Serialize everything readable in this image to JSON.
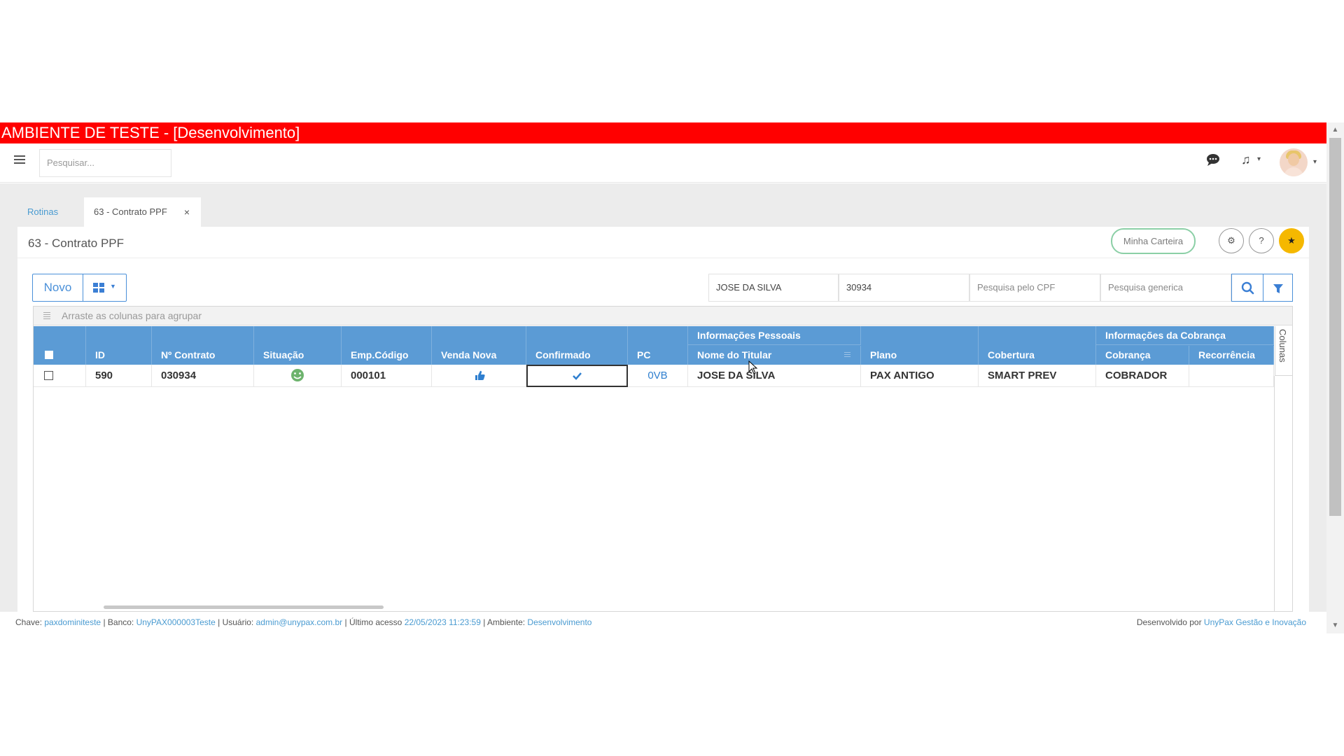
{
  "env_banner": "AMBIENTE DE TESTE - [Desenvolvimento]",
  "topbar": {
    "search_placeholder": "Pesquisar...",
    "icons": [
      "menu-icon",
      "chat-icon",
      "music-icon",
      "avatar"
    ]
  },
  "tabs": {
    "rotinas": "Rotinas",
    "active": "63 - Contrato PPF",
    "close": "×"
  },
  "page": {
    "title": "63 - Contrato PPF",
    "minha_carteira": "Minha Carteira"
  },
  "toolbar": {
    "novo": "Novo"
  },
  "filters": {
    "nome": "JOSE DA SILVA",
    "numero": "30934",
    "cpf_placeholder": "Pesquisa pelo CPF",
    "generic_placeholder": "Pesquisa generica"
  },
  "grid": {
    "group_hint": "Arraste as colunas para agrupar",
    "columns_label": "Colunas",
    "headers": {
      "id": "ID",
      "contrato": "Nº Contrato",
      "situacao": "Situação",
      "emp_codigo": "Emp.Código",
      "venda_nova": "Venda Nova",
      "confirmado": "Confirmado",
      "pc": "PC",
      "info_pessoais": "Informações Pessoais",
      "nome_titular": "Nome do Titular",
      "plano": "Plano",
      "cobertura": "Cobertura",
      "info_cobranca": "Informações da Cobrança",
      "cobranca": "Cobrança",
      "recorrencia": "Recorrência"
    },
    "rows": [
      {
        "id": "590",
        "contrato": "030934",
        "situacao_icon": "smiley-icon",
        "emp_codigo": "000101",
        "venda_nova_icon": "thumbs-up-icon",
        "confirmado_icon": "check-icon",
        "pc": "0VB",
        "nome_titular": "JOSE DA SILVA",
        "plano": "PAX ANTIGO",
        "cobertura": "SMART PREV",
        "cobranca": "COBRADOR",
        "recorrencia": ""
      }
    ]
  },
  "footer": {
    "chave_label": "Chave:",
    "chave": "paxdominiteste",
    "banco_label": "Banco:",
    "banco": "UnyPAX000003Teste",
    "usuario_label": "Usuário:",
    "usuario": "admin@unypax.com.br",
    "acesso_label": "Último acesso",
    "acesso": "22/05/2023 11:23:59",
    "ambiente_label": "Ambiente:",
    "ambiente": "Desenvolvimento",
    "dev_label": "Desenvolvido por",
    "dev": "UnyPax Gestão e Inovação"
  },
  "colors": {
    "banner": "#ff0000",
    "header_blue": "#5b9bd5",
    "accent": "#4a90d9",
    "star": "#f5b800"
  }
}
